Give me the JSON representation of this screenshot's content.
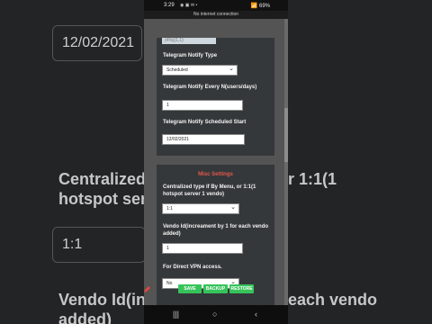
{
  "background": {
    "left_date": "12/02/2021",
    "left_heading_line1": "Centralized",
    "left_heading_line2": "hotspot ser",
    "left_select": "1:1",
    "left_vendo_line1": "Vendo Id(in",
    "left_vendo_line2": "added)",
    "right_heading_line1": "r 1:1(1",
    "right_vendo_line1": "each vendo"
  },
  "status_bar": {
    "time": "3:29",
    "icons": "◉ ▣ ✉ •",
    "right": "📶 69%"
  },
  "connection_notice": "No internet connection",
  "telegram": {
    "top_field": "(4%)(1,1)",
    "notify_type_label": "Telegram Notify Type",
    "notify_type_value": "Scheduled",
    "notify_every_label": "Telegram Notify Every N(users/days)",
    "notify_every_value": "1",
    "scheduled_start_label": "Telegram Notify Scheduled Start",
    "scheduled_start_value": "12/02/2021"
  },
  "misc": {
    "title": "Misc Settings",
    "centralized_label": "Centralized type if By Menu, or 1:1(1 hotspot server 1 vendo)",
    "centralized_value": "1:1",
    "vendo_id_label": "Vendo Id(increament by 1 for each vendo added)",
    "vendo_id_value": "1",
    "direct_vpn_label": "For Direct VPN access.",
    "direct_vpn_value": "No"
  },
  "buttons": {
    "save": "SAVE",
    "backup": "BACKUP",
    "restore": "RESTORE"
  },
  "nav": {
    "recents": "|||",
    "home": "○",
    "back": "‹"
  },
  "colors": {
    "accent_green": "#36c45a",
    "misc_title_red": "#e4574b"
  }
}
